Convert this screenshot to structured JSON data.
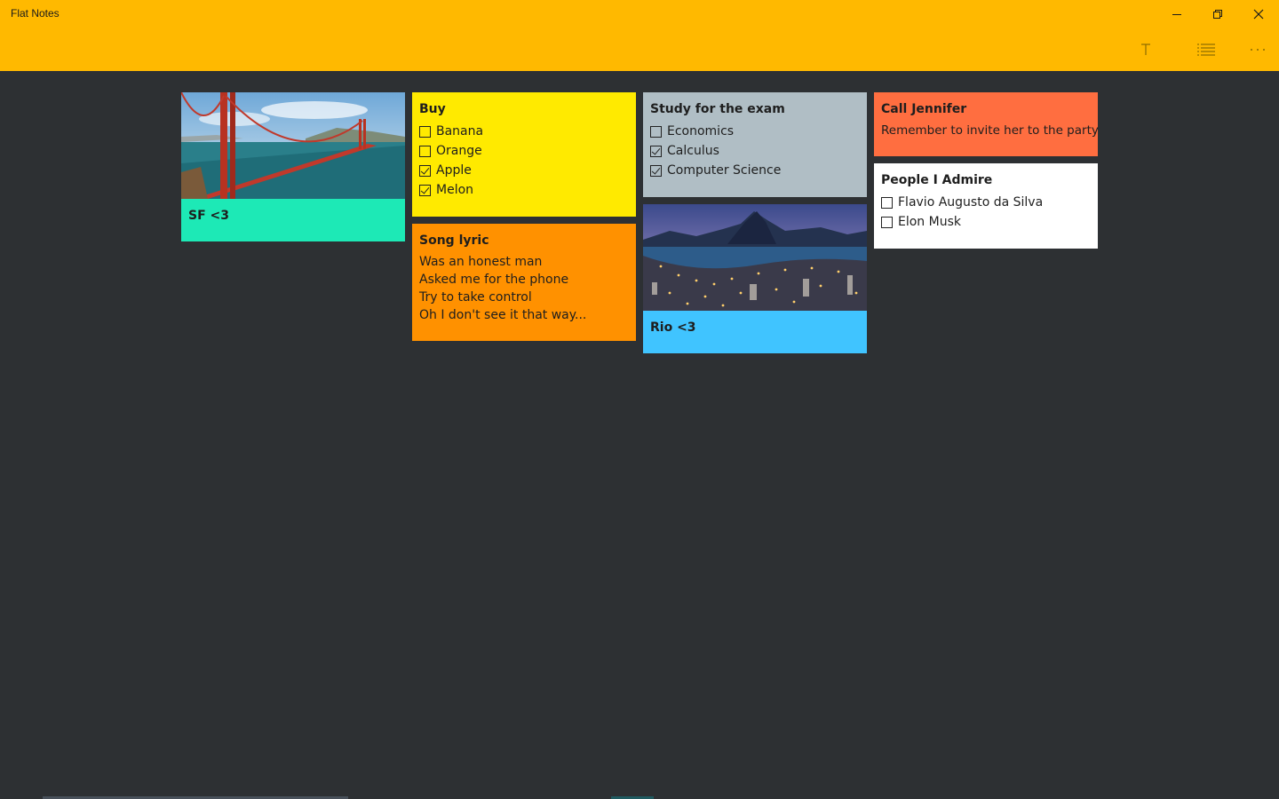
{
  "app": {
    "title": "Flat Notes",
    "accent_color": "#ffb900",
    "background_color": "#2d3033"
  },
  "window_controls": {
    "minimize_icon": "minimize-icon",
    "maximize_icon": "restore-icon",
    "close_icon": "close-icon"
  },
  "toolbar": {
    "text_icon": "text-format-icon",
    "list_icon": "list-icon",
    "more_icon": "more-icon"
  },
  "notes": {
    "sf": {
      "title": "SF <3",
      "color": "#1de9b6",
      "image": "golden-gate-bridge-photo"
    },
    "buy": {
      "title": "Buy",
      "color": "#ffea00",
      "items": [
        {
          "label": "Banana",
          "checked": false
        },
        {
          "label": "Orange",
          "checked": false
        },
        {
          "label": "Apple",
          "checked": true
        },
        {
          "label": "Melon",
          "checked": true
        }
      ]
    },
    "song": {
      "title": "Song lyric",
      "color": "#ff9100",
      "lines": [
        "Was an honest man",
        "Asked me for the phone",
        "Try to take control",
        "Oh I don't see it that way..."
      ]
    },
    "study": {
      "title": "Study for the exam",
      "color": "#b0bec5",
      "items": [
        {
          "label": "Economics",
          "checked": false
        },
        {
          "label": "Calculus",
          "checked": true
        },
        {
          "label": "Computer Science",
          "checked": true
        }
      ]
    },
    "rio": {
      "title": "Rio <3",
      "color": "#40c4ff",
      "image": "rio-de-janeiro-photo"
    },
    "jennifer": {
      "title": "Call Jennifer",
      "color": "#ff6e40",
      "text": "Remember to invite her to the party"
    },
    "admire": {
      "title": "People I Admire",
      "color": "#ffffff",
      "items": [
        {
          "label": "Flavio Augusto da Silva",
          "checked": false
        },
        {
          "label": "Elon Musk",
          "checked": false
        }
      ]
    }
  }
}
